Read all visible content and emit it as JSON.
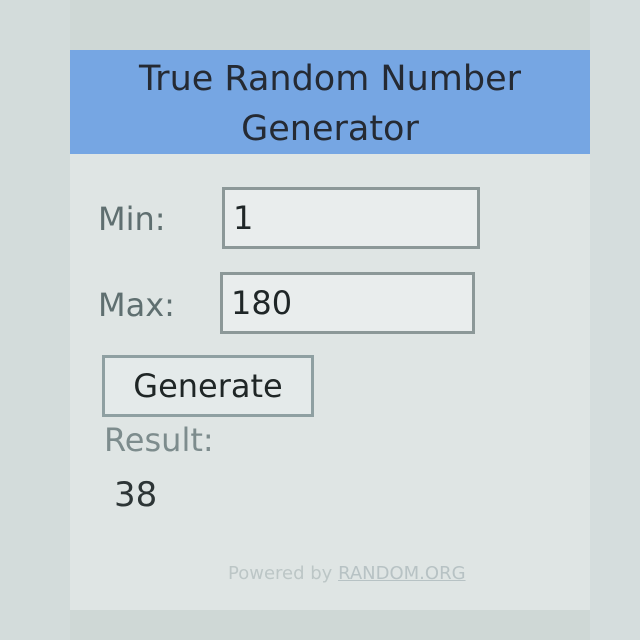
{
  "widget": {
    "title": "True Random Number Generator",
    "min_label": "Min:",
    "min_value": "1",
    "max_label": "Max:",
    "max_value": "180",
    "generate_label": "Generate",
    "result_label": "Result:",
    "result_value": "38",
    "powered_by_text": "Powered by",
    "powered_by_link": "RANDOM.ORG"
  },
  "colors": {
    "header_background": "#76a6e3",
    "panel_background": "#dfe5e4"
  }
}
